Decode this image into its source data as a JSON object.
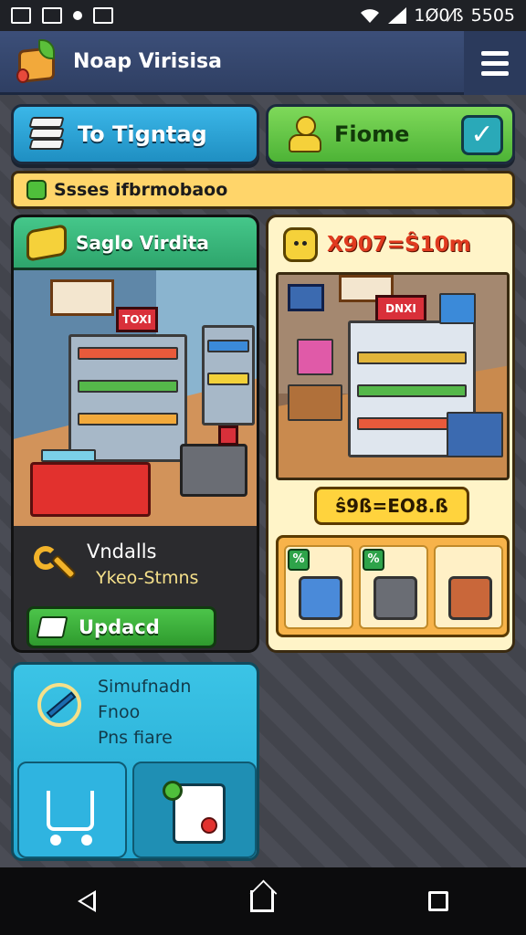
{
  "status_bar": {
    "time": "5505",
    "extra": "1Ø0⁄ß"
  },
  "header": {
    "title": "Noap Virisisa"
  },
  "top_buttons": {
    "left_label": "To Tigntag",
    "right_label": "Fiome"
  },
  "banner": {
    "text": "Ssses ifbrmobaoo"
  },
  "left_card": {
    "title": "Saglo Virdita",
    "shop_sign": "TOXI",
    "info_line1": "Vndalls",
    "info_line2": "Ykeo-Stmns",
    "button_label": "Updacd"
  },
  "right_card": {
    "price_header": "X907=Ŝ10m",
    "shop_sign": "DNXI",
    "price_tag": "ŝ9ß=EO8.ß",
    "slots": [
      {
        "badge": "%"
      },
      {
        "badge": "%"
      },
      {
        "badge": ""
      }
    ]
  },
  "bottom_card": {
    "line1": "Simufnadn",
    "line2": "Fnoo",
    "line3": "Pns fiare"
  },
  "colors": {
    "accent_blue": "#3bb7e8",
    "accent_green": "#4db336",
    "banner": "#ffd56a"
  }
}
